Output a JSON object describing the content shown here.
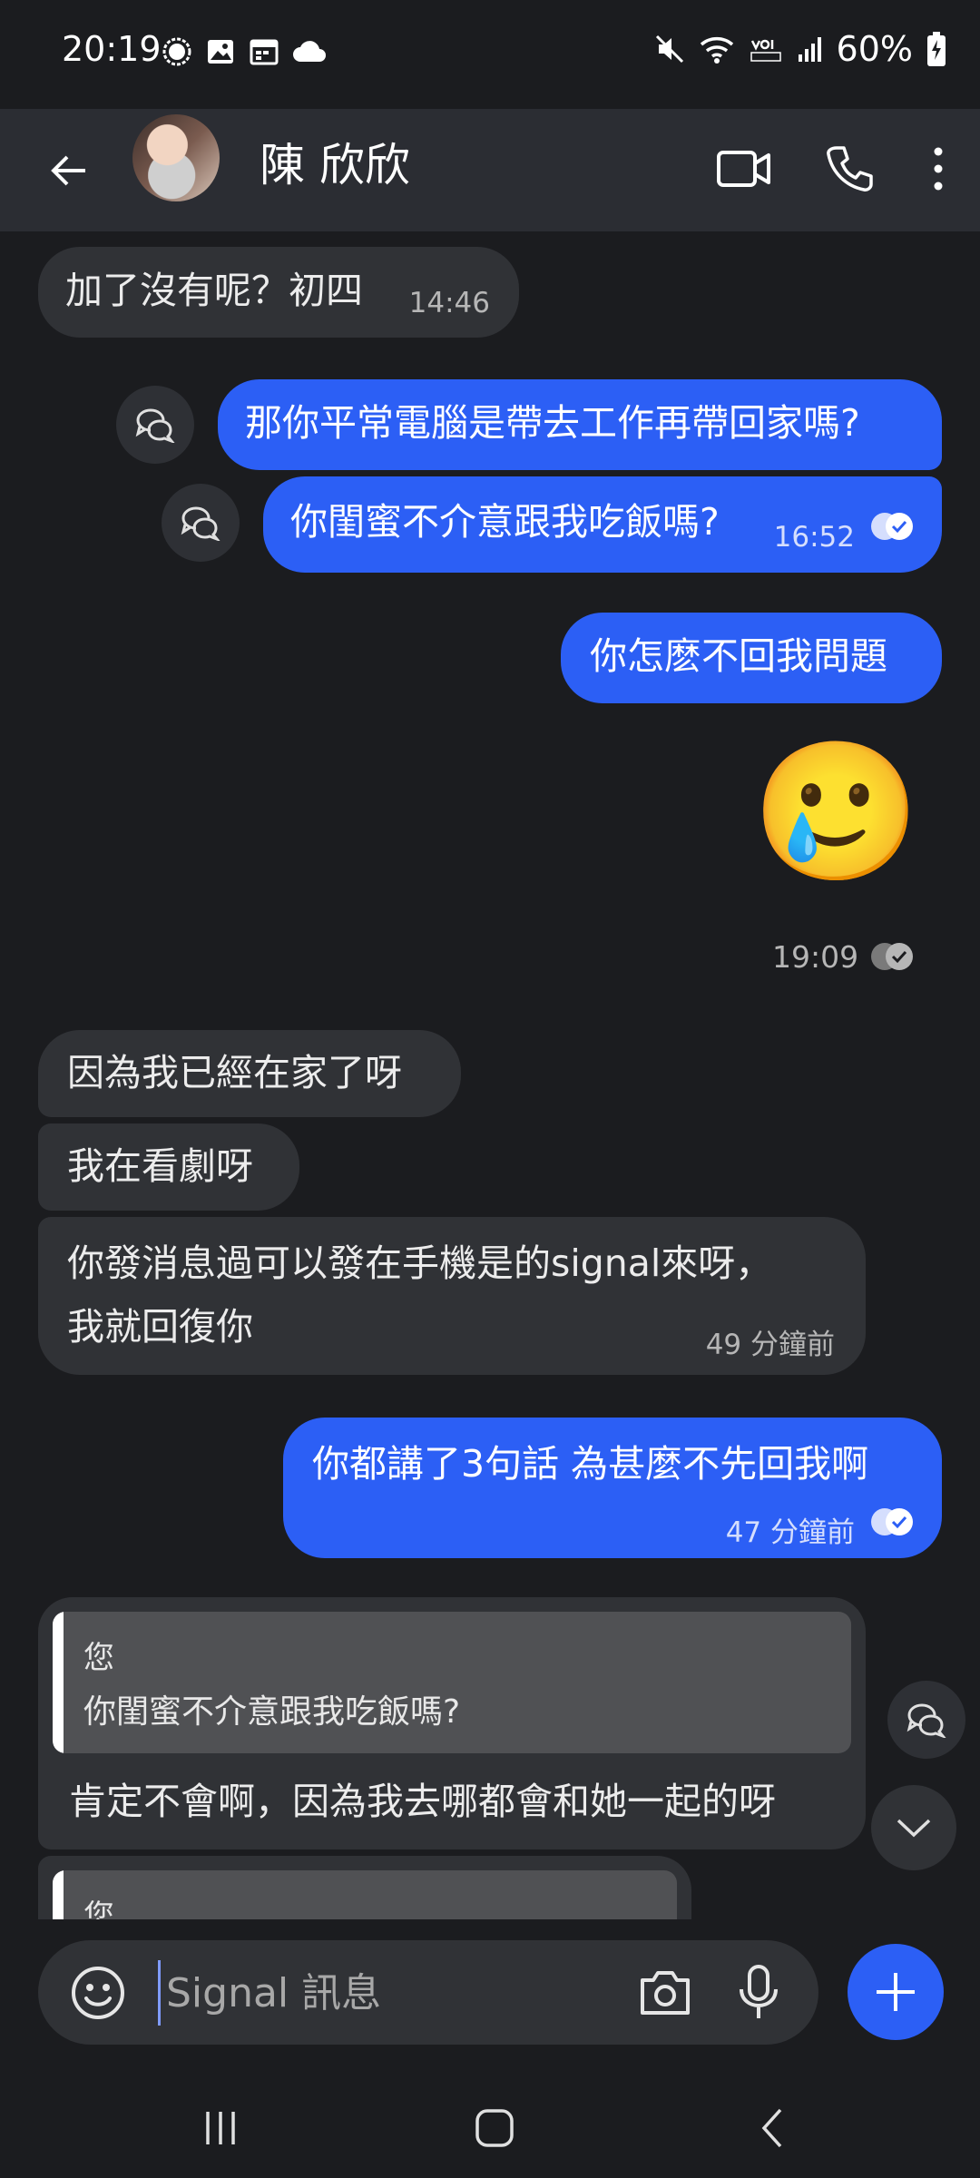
{
  "status_bar": {
    "time": "20:19",
    "battery": "60%"
  },
  "header": {
    "contact_name": "陳 欣欣"
  },
  "messages": [
    {
      "dir": "in",
      "text": "加了沒有呢？初四",
      "time": "14:46"
    },
    {
      "dir": "out",
      "text": "那你平常電腦是帶去工作再帶回家嗎?"
    },
    {
      "dir": "out",
      "text": "你閨蜜不介意跟我吃飯嗎?",
      "time": "16:52"
    },
    {
      "dir": "out",
      "text": "你怎麽不回我問題"
    },
    {
      "dir": "out",
      "emoji": "🥲",
      "time": "19:09"
    },
    {
      "dir": "in",
      "text": "因為我已經在家了呀"
    },
    {
      "dir": "in",
      "text": "我在看劇呀"
    },
    {
      "dir": "in",
      "text_line1": "你發消息過可以發在手機是的signal來呀，",
      "text_line2": "我就回復你",
      "time": "49 分鐘前"
    },
    {
      "dir": "out",
      "text": "你都講了3句話 為甚麼不先回我啊",
      "time": "47 分鐘前"
    },
    {
      "dir": "in",
      "quote_author": "您",
      "quote_text": "你閨蜜不介意跟我吃飯嗎?",
      "text": "肯定不會啊，因為我去哪都會和她一起的呀"
    },
    {
      "dir": "in",
      "quote_author": "您"
    }
  ],
  "composer": {
    "placeholder": "Signal 訊息"
  }
}
